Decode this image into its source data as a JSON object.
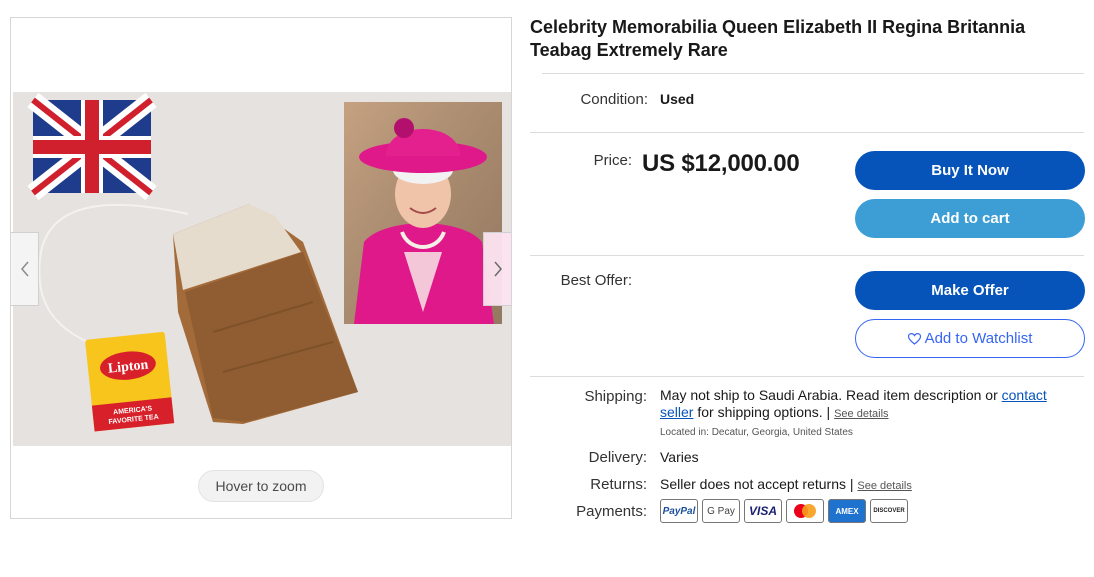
{
  "listing": {
    "title": "Celebrity Memorabilia Queen Elizabeth II Regina Britannia Teabag Extremely Rare",
    "condition_label": "Condition:",
    "condition_value": "Used",
    "price_label": "Price:",
    "price_value": "US $12,000.00",
    "best_offer_label": "Best Offer:"
  },
  "buttons": {
    "buy_now": "Buy It Now",
    "add_to_cart": "Add to cart",
    "make_offer": "Make Offer",
    "watchlist": "Add to Watchlist"
  },
  "gallery": {
    "zoom_hint": "Hover to zoom",
    "tea_brand": "Lipton",
    "tea_tagline_1": "AMERICA'S",
    "tea_tagline_2": "FAVORITE TEA"
  },
  "shipping": {
    "label": "Shipping:",
    "text_1": "May not ship to Saudi Arabia. Read item description or",
    "link_contact": "contact",
    "link_seller": "seller",
    "text_2": "for shipping options. |",
    "see_details": "See details",
    "location": "Located in: Decatur, Georgia, United States"
  },
  "delivery": {
    "label": "Delivery:",
    "value": "Varies"
  },
  "returns": {
    "label": "Returns:",
    "value": "Seller does not accept returns |",
    "see_details": "See details"
  },
  "payments": {
    "label": "Payments:",
    "methods": [
      "PayPal",
      "G Pay",
      "VISA",
      "Mastercard",
      "AMEX",
      "DISCOVER"
    ]
  },
  "colors": {
    "primary_blue": "#0654ba",
    "cart_blue": "#3d9ed6",
    "link_blue": "#3665f3"
  }
}
